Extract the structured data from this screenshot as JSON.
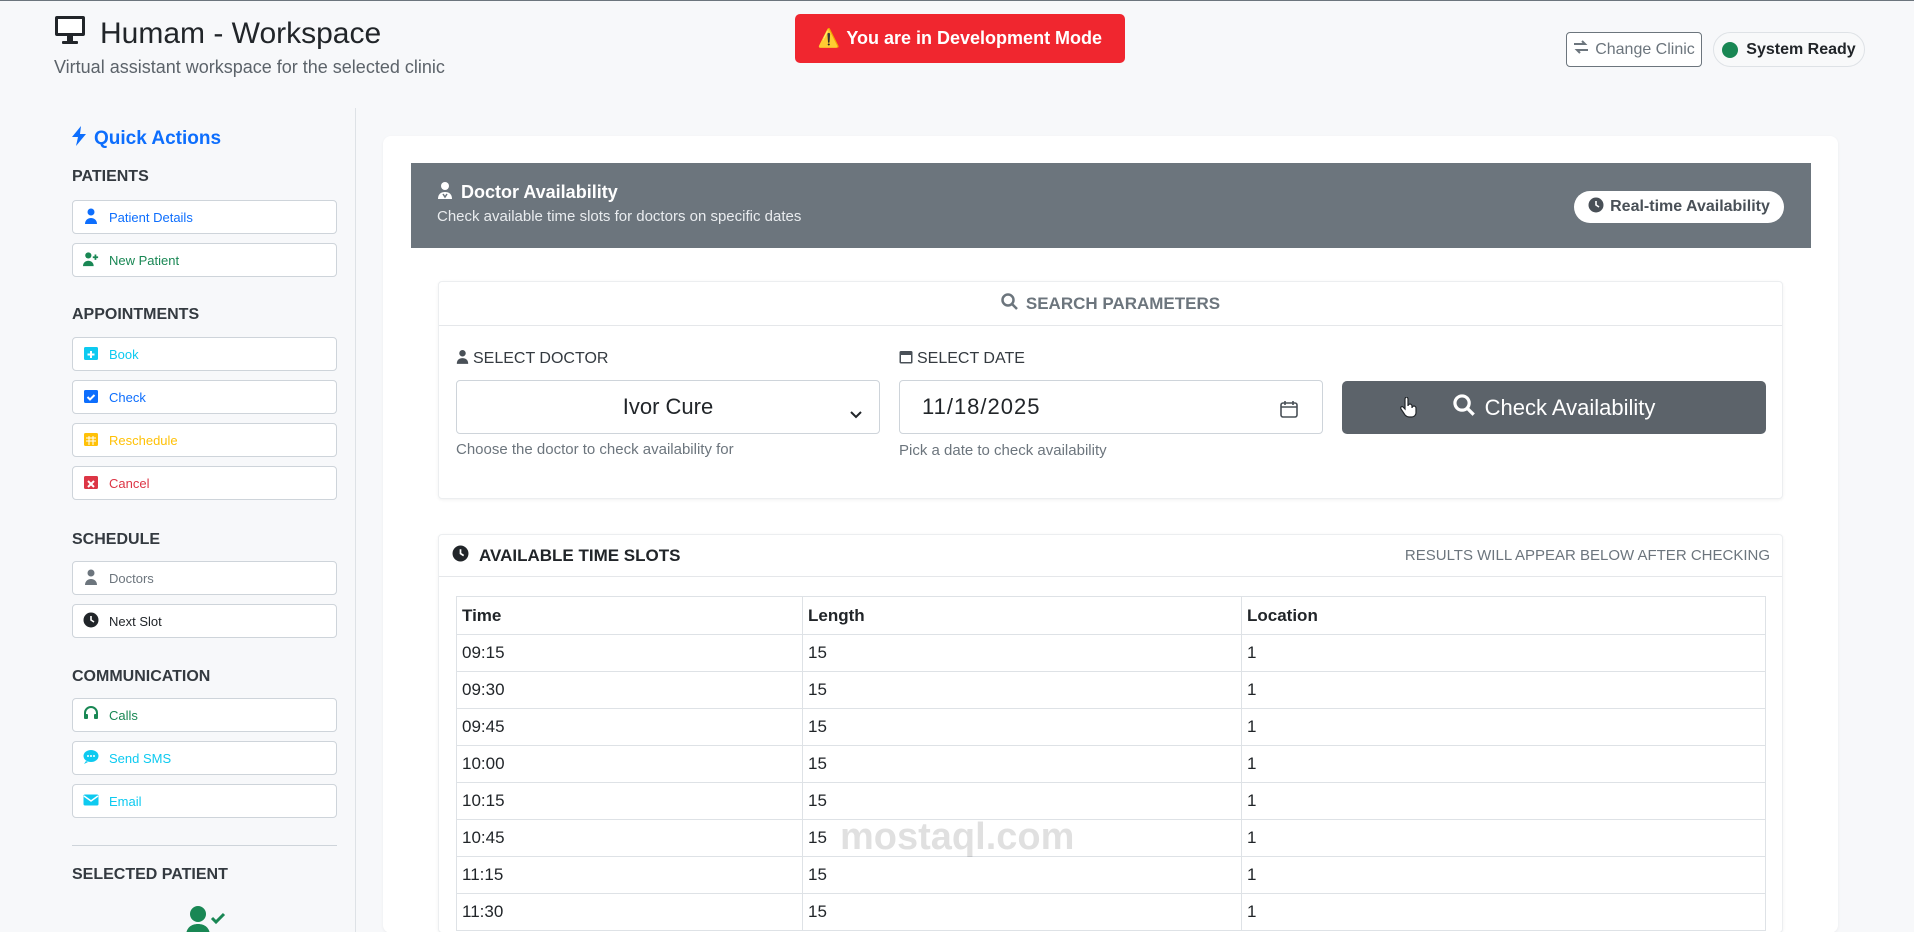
{
  "header": {
    "title": "Humam - Workspace",
    "subtitle": "Virtual assistant workspace for the selected clinic",
    "dev_banner": "You are in Development Mode",
    "change_clinic_label": "Change Clinic",
    "status_label": "System Ready"
  },
  "sidebar": {
    "title": "Quick Actions",
    "sections": [
      {
        "label": "PATIENTS",
        "items": [
          "Patient Details",
          "New Patient"
        ]
      },
      {
        "label": "APPOINTMENTS",
        "items": [
          "Book",
          "Check",
          "Reschedule",
          "Cancel"
        ]
      },
      {
        "label": "SCHEDULE",
        "items": [
          "Doctors",
          "Next Slot"
        ]
      },
      {
        "label": "COMMUNICATION",
        "items": [
          "Calls",
          "Send SMS",
          "Email"
        ]
      }
    ],
    "selected_patient_label": "SELECTED PATIENT"
  },
  "availability": {
    "title": "Doctor Availability",
    "subtitle": "Check available time slots for doctors on specific dates",
    "badge": "Real-time Availability"
  },
  "search": {
    "header": "SEARCH PARAMETERS",
    "doctor_label": "SELECT DOCTOR",
    "doctor_value": "Ivor Cure",
    "doctor_help": "Choose the doctor to check availability for",
    "date_label": "SELECT DATE",
    "date_value": "11/18/2025",
    "date_help": "Pick a date to check availability",
    "check_button": "Check Availability"
  },
  "slots": {
    "title": "AVAILABLE TIME SLOTS",
    "note": "RESULTS WILL APPEAR BELOW AFTER CHECKING",
    "columns": [
      "Time",
      "Length",
      "Location"
    ],
    "rows": [
      [
        "09:15",
        "15",
        "1"
      ],
      [
        "09:30",
        "15",
        "1"
      ],
      [
        "09:45",
        "15",
        "1"
      ],
      [
        "10:00",
        "15",
        "1"
      ],
      [
        "10:15",
        "15",
        "1"
      ],
      [
        "10:45",
        "15",
        "1"
      ],
      [
        "11:15",
        "15",
        "1"
      ],
      [
        "11:30",
        "15",
        "1"
      ]
    ]
  },
  "watermark": "mostaql.com",
  "colors": {
    "primary": "#0d6efd",
    "danger": "#dc3545",
    "warning": "#ffc107",
    "info": "#0dcaf0",
    "success": "#198754",
    "secondary": "#6c757d",
    "dev_banner": "#f0262f"
  }
}
